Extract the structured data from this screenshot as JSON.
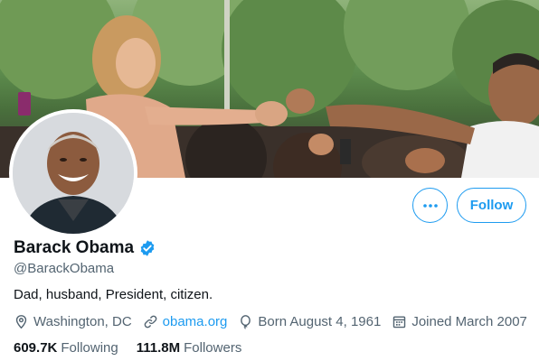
{
  "profile": {
    "name": "Barack Obama",
    "handle": "@BarackObama",
    "bio": "Dad, husband, President, citizen.",
    "verified": true,
    "location": "Washington, DC",
    "website": "obama.org",
    "born": "Born August 4, 1961",
    "joined": "Joined March 2007"
  },
  "stats": {
    "following_count": "609.7K",
    "following_label": "Following",
    "followers_count": "111.8M",
    "followers_label": "Followers"
  },
  "actions": {
    "follow_label": "Follow"
  },
  "icons": {
    "more": "more-horizontal-icon",
    "verified": "verified-badge-icon",
    "location": "location-pin-icon",
    "link": "link-icon",
    "birthday": "balloon-icon",
    "calendar": "calendar-icon"
  },
  "colors": {
    "accent": "#1d9bf0",
    "text": "#0f1419",
    "secondary": "#536471"
  }
}
